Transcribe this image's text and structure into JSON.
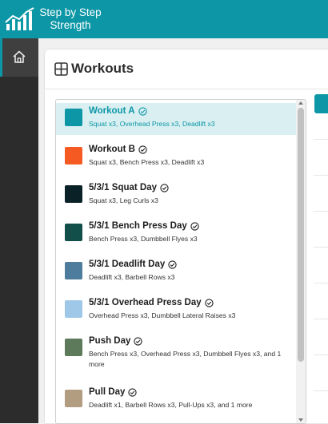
{
  "app": {
    "title_line1": "Step by Step",
    "title_line2": "Strength"
  },
  "nav": {
    "home_icon": "home-icon"
  },
  "page": {
    "title": "Workouts",
    "title_icon": "grid-icon"
  },
  "workouts": [
    {
      "name": "Workout A",
      "exercises": "Squat x3, Overhead Press x3, Deadlift x3",
      "color": "#0d97a6",
      "selected": true
    },
    {
      "name": "Workout B",
      "exercises": "Squat x3, Bench Press x3, Deadlift x3",
      "color": "#f45a22"
    },
    {
      "name": "5/3/1 Squat Day",
      "exercises": "Squat x3, Leg Curls x3",
      "color": "#0b2128"
    },
    {
      "name": "5/3/1 Bench Press Day",
      "exercises": "Bench Press x3, Dumbbell Flyes x3",
      "color": "#134f4a"
    },
    {
      "name": "5/3/1 Deadlift Day",
      "exercises": "Deadlift x3, Barbell Rows x3",
      "color": "#4d7c9c"
    },
    {
      "name": "5/3/1 Overhead Press Day",
      "exercises": "Overhead Press x3, Dumbbell Lateral Raises x3",
      "color": "#9fc8e8"
    },
    {
      "name": "Push Day",
      "exercises": "Bench Press x3, Overhead Press x3, Dumbbell Flyes x3, and 1 more",
      "color": "#5d7a5b"
    },
    {
      "name": "Pull Day",
      "exercises": "Deadlift x1, Barbell Rows x3, Pull-Ups x3, and 1 more",
      "color": "#b39d80"
    }
  ],
  "colors": {
    "accent": "#0d97a6",
    "sidebar": "#2c2c2c",
    "selected_bg": "#d9eff1"
  }
}
